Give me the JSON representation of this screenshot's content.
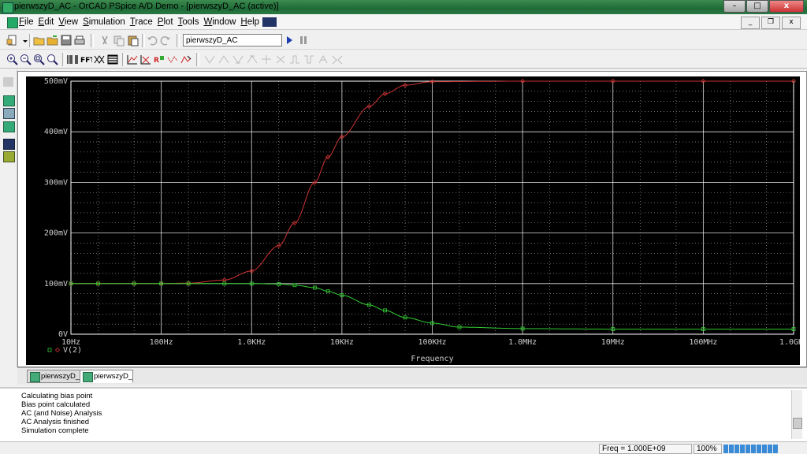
{
  "window": {
    "title": "pierwszyD_AC - OrCAD PSpice A/D Demo - [pierwszyD_AC (active)]"
  },
  "menu": [
    "File",
    "Edit",
    "View",
    "Simulation",
    "Trace",
    "Plot",
    "Tools",
    "Window",
    "Help"
  ],
  "toolbar": {
    "simulation_profile": "pierwszyD_AC"
  },
  "doc_tabs": [
    {
      "label": "pierwszyD_...",
      "active": false
    },
    {
      "label": "pierwszyD_A...",
      "active": true
    }
  ],
  "output_log": [
    "Calculating bias point",
    "Bias point calculated",
    "AC (and Noise) Analysis",
    "AC Analysis finished",
    "Simulation complete"
  ],
  "status": {
    "freq": "Freq = 1.000E+09",
    "zoom": "100%"
  },
  "colors": {
    "trace_red": "#cc3333",
    "trace_green": "#33cc33",
    "plot_bg": "#000000",
    "grid": "#ffffff",
    "axis_text": "#cccccc"
  },
  "chart_data": {
    "type": "line",
    "xscale": "log",
    "xlabel": "Frequency",
    "ylabel": "",
    "x_ticks": [
      "10Hz",
      "100Hz",
      "1.0KHz",
      "10KHz",
      "100KHz",
      "1.0MHz",
      "10MHz",
      "100MHz",
      "1.0GHz"
    ],
    "y_ticks": [
      "0V",
      "100mV",
      "200mV",
      "300mV",
      "400mV",
      "500mV"
    ],
    "xlim": [
      10,
      1000000000
    ],
    "ylim": [
      0,
      0.5
    ],
    "series": [
      {
        "name": "",
        "color": "#cc3333",
        "marker": "diamond",
        "x": [
          10,
          20,
          50,
          100,
          200,
          500,
          1000,
          2000,
          3000,
          5000,
          7000,
          10000,
          20000,
          30000,
          50000,
          100000,
          1000000,
          10000000,
          100000000,
          1000000000
        ],
        "y": [
          0.1,
          0.1,
          0.1,
          0.1,
          0.101,
          0.107,
          0.125,
          0.175,
          0.22,
          0.3,
          0.35,
          0.39,
          0.45,
          0.475,
          0.492,
          0.499,
          0.5,
          0.5,
          0.5,
          0.5
        ]
      },
      {
        "name": "V(2)",
        "color": "#33cc33",
        "marker": "square",
        "x": [
          10,
          20,
          50,
          100,
          200,
          500,
          1000,
          2000,
          3000,
          5000,
          7000,
          10000,
          20000,
          30000,
          50000,
          100000,
          200000,
          1000000,
          10000000,
          100000000,
          1000000000
        ],
        "y": [
          0.1,
          0.1,
          0.1,
          0.1,
          0.1,
          0.1,
          0.1,
          0.099,
          0.097,
          0.092,
          0.085,
          0.077,
          0.058,
          0.047,
          0.033,
          0.022,
          0.014,
          0.011,
          0.01,
          0.01,
          0.01
        ]
      }
    ],
    "legend": [
      {
        "label": "V(2)",
        "marker": "square",
        "color": "#33cc33"
      }
    ],
    "grid": true
  }
}
